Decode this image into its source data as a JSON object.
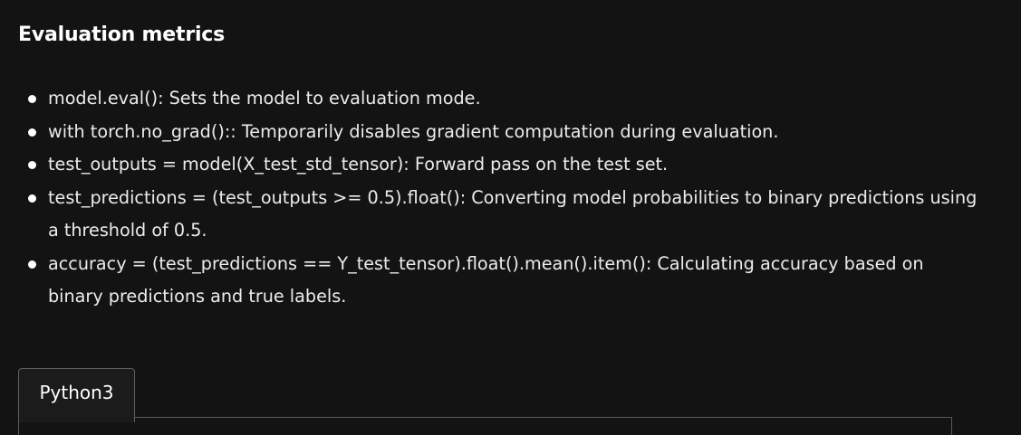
{
  "section": {
    "title": "Evaluation metrics"
  },
  "bullets": [
    "model.eval(): Sets the model to evaluation mode.",
    "with torch.no_grad():: Temporarily disables gradient computation during evaluation.",
    "test_outputs = model(X_test_std_tensor): Forward pass on the test set.",
    "test_predictions = (test_outputs >= 0.5).float(): Converting model probabilities to binary predictions using a threshold of 0.5.",
    "accuracy = (test_predictions == Y_test_tensor).float().mean().item(): Calculating accuracy based on binary predictions and true labels."
  ],
  "code_block": {
    "language_tab": "Python3"
  }
}
